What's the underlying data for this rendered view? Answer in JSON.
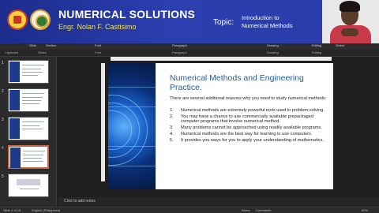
{
  "banner": {
    "title": "NUMERICAL SOLUTIONS",
    "subtitle": "Engr. Nolan F. Castisimo",
    "topic_label": "Topic:",
    "topic_line1": "Introduction to",
    "topic_line2": "Numerical Methods"
  },
  "ribbon": {
    "tabs": [
      "Slide",
      "Section",
      "Font",
      "Paragraph",
      "Drawing",
      "Editing",
      "Select"
    ],
    "groups": [
      "Clipboard",
      "Slides",
      "Font",
      "Paragraph",
      "Drawing",
      "Editing"
    ]
  },
  "sidebar": {
    "slide_numbers": [
      "1",
      "2",
      "3",
      "4",
      "5"
    ],
    "selected": "4"
  },
  "slide": {
    "title": "Numerical Methods and Engineering Practice.",
    "intro": "There are several additional reasons why you need to study numerical methods:",
    "items": [
      {
        "num": "1.",
        "text": "Numerical methods are extremely powerful tools used in problem-solving."
      },
      {
        "num": "2.",
        "text": "You may have a chance to use commercially available prepackaged computer programs that involve numerical method."
      },
      {
        "num": "3.",
        "text": "Many problems cannot be approached using readily available programs."
      },
      {
        "num": "4.",
        "text": "Numerical methods are the best way for learning to use computers."
      },
      {
        "num": "5.",
        "text": "It provides you ways for you to apply your understanding of mathematics."
      }
    ]
  },
  "notes": {
    "placeholder": "Click to add notes"
  },
  "status": {
    "slide_info": "Slide 4 of 15",
    "language": "English (Philippines)",
    "notes_btn": "Notes",
    "comments_btn": "Comments",
    "zoom": "83%"
  }
}
